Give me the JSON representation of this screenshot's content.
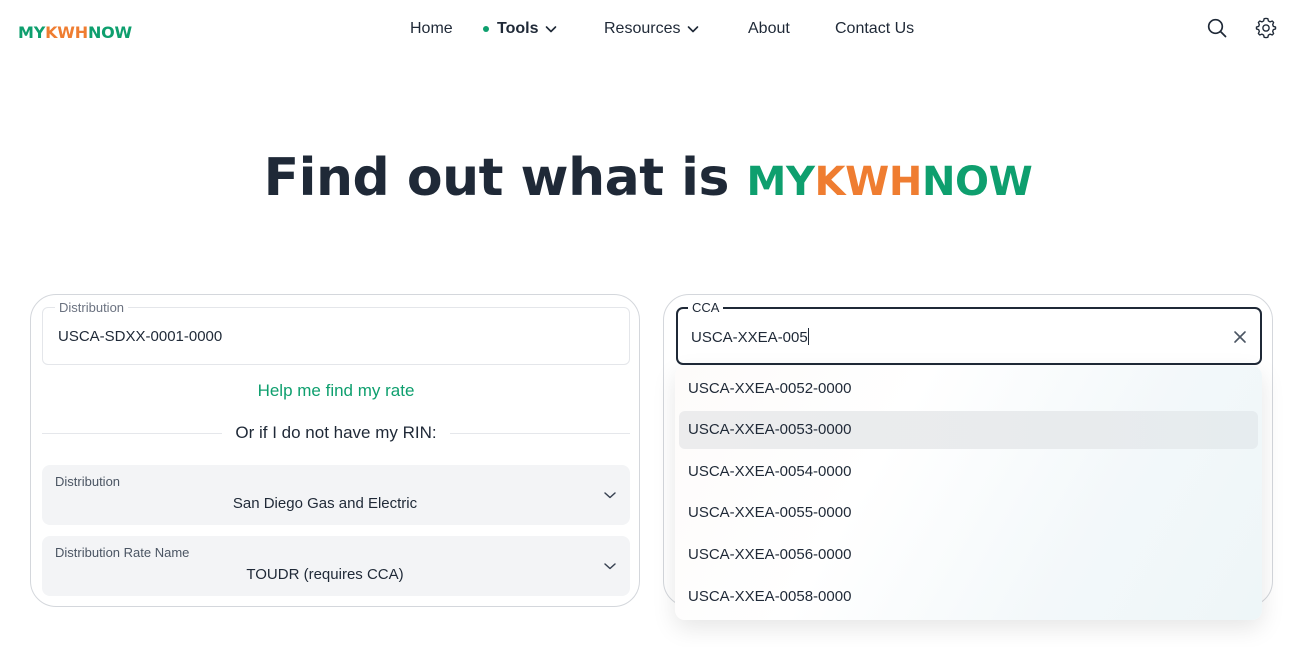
{
  "brand": {
    "part1": "MY",
    "part2": "KWH",
    "part3": "NOW"
  },
  "nav": {
    "home": "Home",
    "tools": "Tools",
    "resources": "Resources",
    "about": "About",
    "contact": "Contact Us"
  },
  "icons": {
    "search": "search-icon",
    "settings": "gear-icon"
  },
  "hero": {
    "prefix": "Find out what is"
  },
  "left_card": {
    "distribution_label": "Distribution",
    "distribution_value": "USCA-SDXX-0001-0000",
    "help_link": "Help me find my rate",
    "divider_text": "Or if I do not have my RIN:",
    "select_distribution": {
      "label": "Distribution",
      "value": "San Diego Gas and Electric"
    },
    "select_rate": {
      "label": "Distribution Rate Name",
      "value": "TOUDR (requires CCA)"
    }
  },
  "right_card": {
    "cca_label": "CCA",
    "cca_value": "USCA-XXEA-005",
    "options": [
      "USCA-XXEA-0052-0000",
      "USCA-XXEA-0053-0000",
      "USCA-XXEA-0054-0000",
      "USCA-XXEA-0055-0000",
      "USCA-XXEA-0056-0000",
      "USCA-XXEA-0058-0000"
    ],
    "highlighted_option": "USCA-XXEA-0053-0000"
  },
  "colors": {
    "green": "#0e9f6e",
    "orange": "#ef7d31",
    "text": "#1f2937"
  }
}
